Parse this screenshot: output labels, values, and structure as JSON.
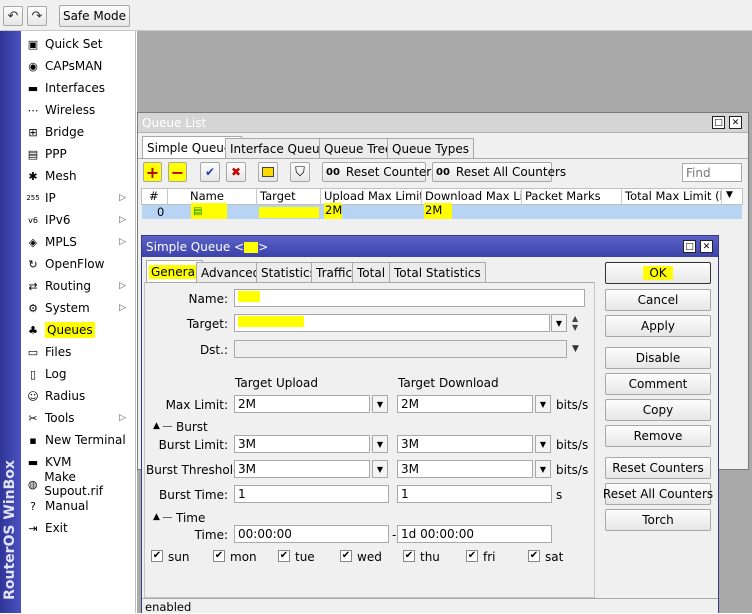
{
  "toolbar": {
    "safe_mode_label": "Safe Mode"
  },
  "brand": "RouterOS WinBox",
  "sidebar": {
    "items": [
      {
        "label": "Quick Set",
        "icon": "quickset-icon",
        "glyph": "▣",
        "arrow": false
      },
      {
        "label": "CAPsMAN",
        "icon": "capsman-icon",
        "glyph": "◉",
        "arrow": false
      },
      {
        "label": "Interfaces",
        "icon": "interfaces-icon",
        "glyph": "▬",
        "arrow": false
      },
      {
        "label": "Wireless",
        "icon": "wireless-icon",
        "glyph": "⋯",
        "arrow": false
      },
      {
        "label": "Bridge",
        "icon": "bridge-icon",
        "glyph": "⊞",
        "arrow": false
      },
      {
        "label": "PPP",
        "icon": "ppp-icon",
        "glyph": "▤",
        "arrow": false
      },
      {
        "label": "Mesh",
        "icon": "mesh-icon",
        "glyph": "✱",
        "arrow": false
      },
      {
        "label": "IP",
        "icon": "ip-icon",
        "glyph": "255",
        "arrow": true
      },
      {
        "label": "IPv6",
        "icon": "ipv6-icon",
        "glyph": "v6",
        "arrow": true
      },
      {
        "label": "MPLS",
        "icon": "mpls-icon",
        "glyph": "◈",
        "arrow": true
      },
      {
        "label": "OpenFlow",
        "icon": "openflow-icon",
        "glyph": "↻",
        "arrow": false
      },
      {
        "label": "Routing",
        "icon": "routing-icon",
        "glyph": "⇄",
        "arrow": true
      },
      {
        "label": "System",
        "icon": "system-icon",
        "glyph": "⚙",
        "arrow": true
      },
      {
        "label": "Queues",
        "icon": "queues-icon",
        "glyph": "♣",
        "arrow": false
      },
      {
        "label": "Files",
        "icon": "files-icon",
        "glyph": "▭",
        "arrow": false
      },
      {
        "label": "Log",
        "icon": "log-icon",
        "glyph": "▯",
        "arrow": false
      },
      {
        "label": "Radius",
        "icon": "radius-icon",
        "glyph": "☺",
        "arrow": false
      },
      {
        "label": "Tools",
        "icon": "tools-icon",
        "glyph": "✂",
        "arrow": true
      },
      {
        "label": "New Terminal",
        "icon": "terminal-icon",
        "glyph": "▪",
        "arrow": false
      },
      {
        "label": "KVM",
        "icon": "kvm-icon",
        "glyph": "▬",
        "arrow": false
      },
      {
        "label": "Make Supout.rif",
        "icon": "supout-icon",
        "glyph": "◍",
        "arrow": false
      },
      {
        "label": "Manual",
        "icon": "manual-icon",
        "glyph": "?",
        "arrow": false
      },
      {
        "label": "Exit",
        "icon": "exit-icon",
        "glyph": "⇥",
        "arrow": false
      }
    ]
  },
  "queue_list": {
    "title": "Queue List",
    "tabs": [
      "Simple Queues",
      "Interface Queues",
      "Queue Tree",
      "Queue Types"
    ],
    "reset_counters": "Reset Counters",
    "reset_all_counters": "Reset All Counters",
    "find_placeholder": "Find",
    "columns": [
      "#",
      "Name",
      "Target",
      "Upload Max Limit",
      "Download Max Limit",
      "Packet Marks",
      "Total Max Limit (bi..."
    ],
    "row": {
      "index": "0",
      "upload": "2M",
      "download": "2M"
    }
  },
  "dialog": {
    "title": "Simple Queue <",
    "title_end": ">",
    "tabs": [
      "General",
      "Advanced",
      "Statistics",
      "Traffic",
      "Total",
      "Total Statistics"
    ],
    "name_label": "Name:",
    "target_label": "Target:",
    "dst_label": "Dst.:",
    "target_upload": "Target Upload",
    "target_download": "Target Download",
    "max_limit_label": "Max Limit:",
    "max_limit_up": "2M",
    "max_limit_down": "2M",
    "unit_bits": "bits/s",
    "burst_section": "Burst",
    "burst_limit_label": "Burst Limit:",
    "burst_limit_up": "3M",
    "burst_limit_down": "3M",
    "burst_threshold_label": "Burst Threshold:",
    "burst_threshold_up": "3M",
    "burst_threshold_down": "3M",
    "burst_time_label": "Burst Time:",
    "burst_time_up": "1",
    "burst_time_down": "1",
    "unit_s": "s",
    "time_section": "Time",
    "time_label": "Time:",
    "time_from": "00:00:00",
    "time_dash": "-",
    "time_to": "1d 00:00:00",
    "days": [
      "sun",
      "mon",
      "tue",
      "wed",
      "thu",
      "fri",
      "sat"
    ],
    "status": "enabled",
    "buttons": [
      "OK",
      "Cancel",
      "Apply",
      "Disable",
      "Comment",
      "Copy",
      "Remove",
      "Reset Counters",
      "Reset All Counters",
      "Torch"
    ]
  },
  "colors": {
    "highlight": "#ffff00",
    "sidebar_blue": "#3c43a8",
    "title_bar": "#d9d9d9",
    "selected_row": "#b8d4f4"
  }
}
